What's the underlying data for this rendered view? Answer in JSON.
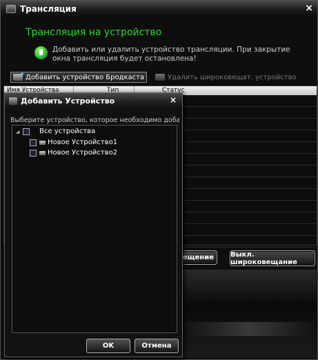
{
  "window": {
    "title": "Трансляция",
    "close_glyph": "×",
    "heading": "Трансляция на устройство",
    "info": "Добавить или удалить устройство трансляции. При закрытие окна трансляция будет остановлена!",
    "toolbar": {
      "add_label": "Добавить устройство Бродкаста",
      "remove_label": "Удалить широковещат. устройство"
    },
    "grid": {
      "columns": [
        "Имя Устройства",
        "Тип",
        "Статус"
      ]
    },
    "start_label": "вещение",
    "stop_label": "Выкл. широковещание"
  },
  "dialog": {
    "title": "Добавить Устройство",
    "close_glyph": "×",
    "prompt": "Выберите устройство, которое необходимо добави",
    "tree": {
      "root_label": "Все устройства",
      "expander_glyph": "◢",
      "children": [
        "Новое Устройство1",
        "Новое Устройство2"
      ]
    },
    "ok_label": "OK",
    "cancel_label": "Отмена"
  },
  "colors": {
    "heading": "#29d629",
    "background": "#0e0e0e"
  },
  "icons": [
    "app-icon",
    "info-icon",
    "add-device-icon",
    "remove-device-icon",
    "device-icon"
  ]
}
